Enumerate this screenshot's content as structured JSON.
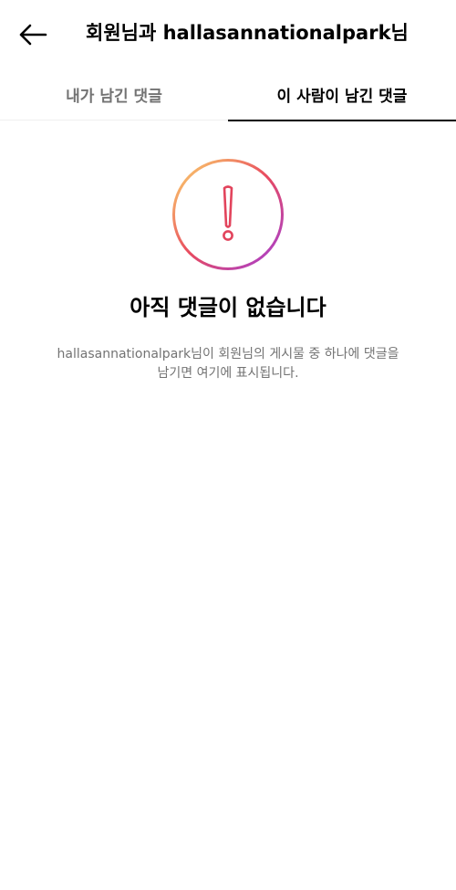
{
  "header": {
    "title": "회원님과 hallasannationalpark님",
    "back_icon": "arrow-left-icon"
  },
  "tabs": [
    {
      "label": "내가 남긴 댓글",
      "active": false
    },
    {
      "label": "이 사람이 남긴 댓글",
      "active": true
    }
  ],
  "empty_state": {
    "icon": "alert-circle-icon",
    "title": "아직 댓글이 없습니다",
    "description_line1": "hallasannationalpark님이 회원님의 게시물 중 하나에 댓글을",
    "description_line2": "남기면 여기에 표시됩니다."
  },
  "colors": {
    "inactive_tab": "#737373",
    "active_tab": "#000000",
    "gradient_start": "#fcd96b",
    "gradient_mid": "#e84a5f",
    "gradient_end": "#a23fd8"
  }
}
